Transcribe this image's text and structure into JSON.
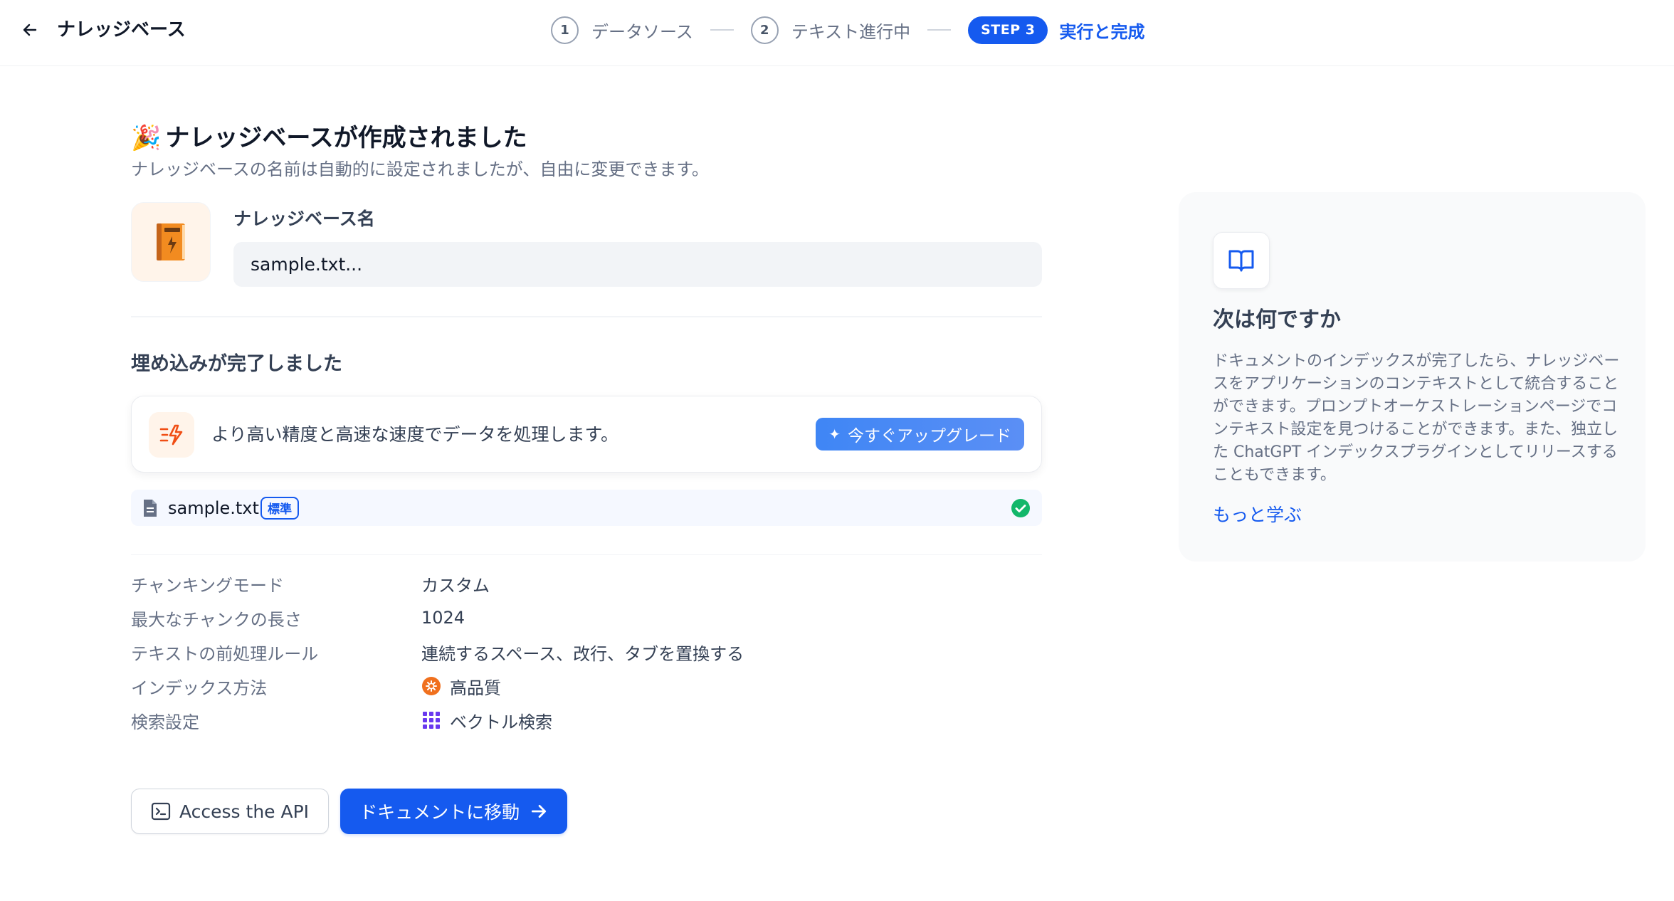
{
  "header": {
    "title": "ナレッジベース",
    "steps": [
      {
        "num": "1",
        "label": "データソース"
      },
      {
        "num": "2",
        "label": "テキスト進行中"
      },
      {
        "num": "STEP 3",
        "label": "実行と完成"
      }
    ]
  },
  "main": {
    "success_emoji": "🎉",
    "success_title": "ナレッジベースが作成されました",
    "success_subtitle": "ナレッジベースの名前は自動的に設定されましたが、自由に変更できます。",
    "name_label": "ナレッジベース名",
    "name_value": "sample.txt...",
    "embedding_title": "埋め込みが完了しました",
    "upgrade_text": "より高い精度と高速な速度でデータを処理します。",
    "upgrade_button": "今すぐアップグレード",
    "file": {
      "name": "sample.txt",
      "badge": "標準",
      "status": "completed"
    },
    "info": [
      {
        "key": "チャンキングモード",
        "value": "カスタム",
        "icon": ""
      },
      {
        "key": "最大なチャンクの長さ",
        "value": "1024",
        "icon": ""
      },
      {
        "key": "テキストの前処理ルール",
        "value": "連続するスペース、改行、タブを置換する",
        "icon": ""
      },
      {
        "key": "インデックス方法",
        "value": "高品質",
        "icon": "high-quality-icon"
      },
      {
        "key": "検索設定",
        "value": "ベクトル検索",
        "icon": "vector-search-icon"
      }
    ],
    "api_button": "Access the API",
    "go_button": "ドキュメントに移動"
  },
  "side": {
    "icon": "book-icon",
    "title": "次は何ですか",
    "body": "ドキュメントのインデックスが完了したら、ナレッジベースをアプリケーションのコンテキストとして統合することができます。プロンプトオーケストレーションページでコンテキスト設定を見つけることができます。また、独立した ChatGPT インデックスプラグインとしてリリースすることもできます。",
    "link": "もっと学ぶ"
  },
  "colors": {
    "primary": "#155aef",
    "success": "#12b76a",
    "orange": "#f79009"
  }
}
